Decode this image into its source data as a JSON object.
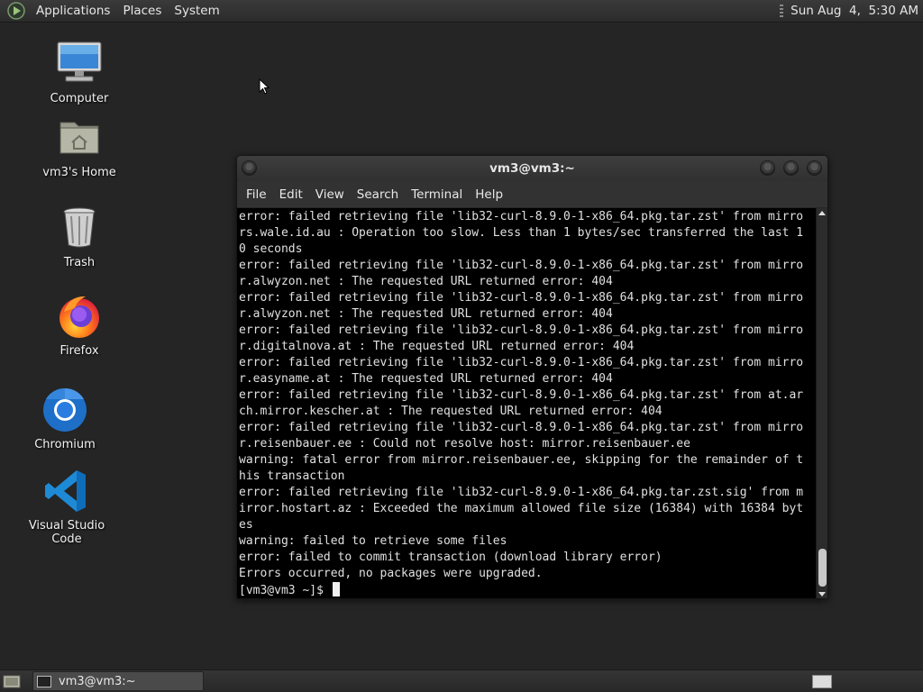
{
  "top_panel": {
    "menus": [
      "Applications",
      "Places",
      "System"
    ],
    "clock": "Sun Aug  4,  5:30 AM"
  },
  "desktop_icons": [
    {
      "label": "Computer",
      "icon": "computer-icon"
    },
    {
      "label": "vm3's Home",
      "icon": "home-folder-icon"
    },
    {
      "label": "Trash",
      "icon": "trash-icon"
    },
    {
      "label": "Firefox",
      "icon": "firefox-icon"
    },
    {
      "label": "Chromium",
      "icon": "chromium-icon"
    },
    {
      "label": "Visual Studio Code",
      "icon": "vscode-icon"
    }
  ],
  "terminal": {
    "title": "vm3@vm3:~",
    "menu": [
      "File",
      "Edit",
      "View",
      "Search",
      "Terminal",
      "Help"
    ],
    "lines": [
      "error: failed retrieving file 'lib32-curl-8.9.0-1-x86_64.pkg.tar.zst' from mirro",
      "rs.wale.id.au : Operation too slow. Less than 1 bytes/sec transferred the last 1",
      "0 seconds",
      "error: failed retrieving file 'lib32-curl-8.9.0-1-x86_64.pkg.tar.zst' from mirro",
      "r.alwyzon.net : The requested URL returned error: 404",
      "error: failed retrieving file 'lib32-curl-8.9.0-1-x86_64.pkg.tar.zst' from mirro",
      "r.alwyzon.net : The requested URL returned error: 404",
      "error: failed retrieving file 'lib32-curl-8.9.0-1-x86_64.pkg.tar.zst' from mirro",
      "r.digitalnova.at : The requested URL returned error: 404",
      "error: failed retrieving file 'lib32-curl-8.9.0-1-x86_64.pkg.tar.zst' from mirro",
      "r.easyname.at : The requested URL returned error: 404",
      "error: failed retrieving file 'lib32-curl-8.9.0-1-x86_64.pkg.tar.zst' from at.ar",
      "ch.mirror.kescher.at : The requested URL returned error: 404",
      "error: failed retrieving file 'lib32-curl-8.9.0-1-x86_64.pkg.tar.zst' from mirro",
      "r.reisenbauer.ee : Could not resolve host: mirror.reisenbauer.ee",
      "warning: fatal error from mirror.reisenbauer.ee, skipping for the remainder of t",
      "his transaction",
      "error: failed retrieving file 'lib32-curl-8.9.0-1-x86_64.pkg.tar.zst.sig' from m",
      "irror.hostart.az : Exceeded the maximum allowed file size (16384) with 16384 byt",
      "es",
      "warning: failed to retrieve some files",
      "error: failed to commit transaction (download library error)",
      "Errors occurred, no packages were upgraded."
    ],
    "prompt": "[vm3@vm3 ~]$ "
  },
  "taskbar": {
    "window_label": "vm3@vm3:~"
  }
}
